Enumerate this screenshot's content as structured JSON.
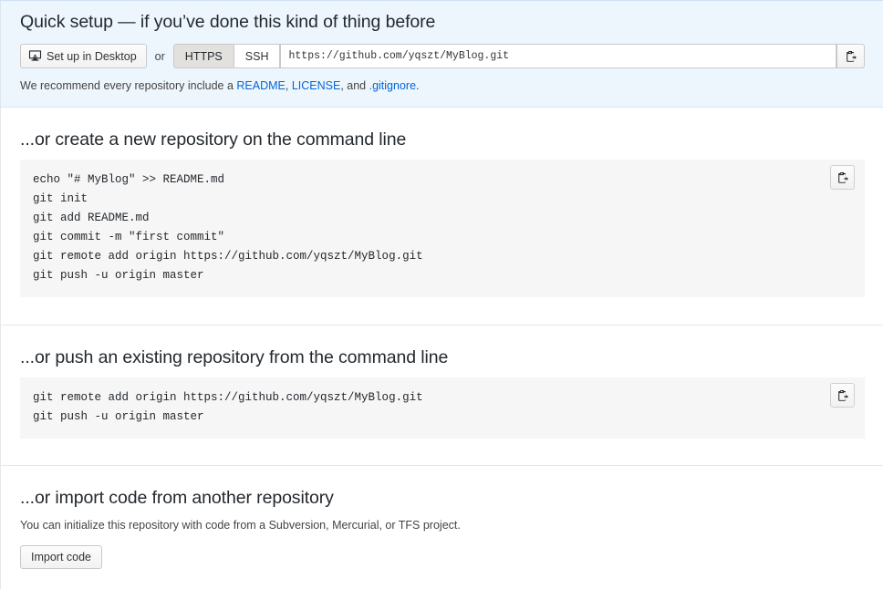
{
  "quick_setup": {
    "title": "Quick setup — if you’ve done this kind of thing before",
    "desktop_button_label": "Set up in Desktop",
    "desktop_icon": "desktop-download-icon",
    "or_label": "or",
    "protocols": [
      {
        "label": "HTTPS",
        "selected": true
      },
      {
        "label": "SSH",
        "selected": false
      }
    ],
    "clone_url": "https://github.com/yqszt/MyBlog.git",
    "clone_url_placeholder": "https://github.com/yqszt/MyBlog.git",
    "copy_icon": "clipboard-copy-icon",
    "note": {
      "prefix": "We recommend every repository include a ",
      "link_readme": "README",
      "sep1": ", ",
      "link_license": "LICENSE",
      "sep2": ", and ",
      "link_gitignore": ".gitignore",
      "suffix": "."
    }
  },
  "create_section": {
    "title": "...or create a new repository on the command line",
    "copy_icon": "clipboard-copy-icon",
    "commands": [
      "echo \"# MyBlog\" >> README.md",
      "git init",
      "git add README.md",
      "git commit -m \"first commit\"",
      "git remote add origin https://github.com/yqszt/MyBlog.git",
      "git push -u origin master"
    ]
  },
  "push_section": {
    "title": "...or push an existing repository from the command line",
    "copy_icon": "clipboard-copy-icon",
    "commands": [
      "git remote add origin https://github.com/yqszt/MyBlog.git",
      "git push -u origin master"
    ]
  },
  "import_section": {
    "title": "...or import code from another repository",
    "description": "You can initialize this repository with code from a Subversion, Mercurial, or TFS project.",
    "button_label": "Import code"
  },
  "colors": {
    "panel_background": "#eef6fd",
    "panel_border": "#d8e6f3",
    "code_background": "#f6f6f6",
    "link": "#0366d6",
    "text": "#24292e",
    "selected_tab": "#e3e1dd"
  }
}
